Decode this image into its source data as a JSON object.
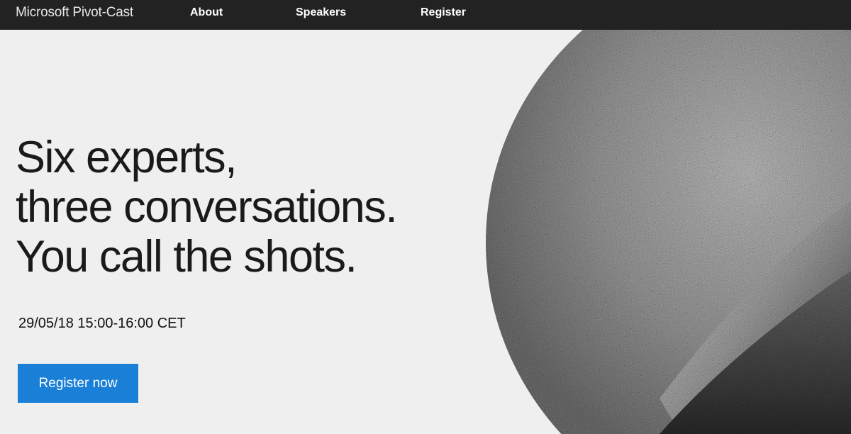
{
  "nav": {
    "brand": "Microsoft Pivot-Cast",
    "links": [
      {
        "label": "About"
      },
      {
        "label": "Speakers"
      },
      {
        "label": "Register"
      }
    ]
  },
  "hero": {
    "headline_lines": [
      "Six experts,",
      "three conversations.",
      "You call the shots."
    ],
    "date": "29/05/18 15:00-16:00 CET",
    "cta_label": "Register now"
  },
  "colors": {
    "navbar_bg": "#222222",
    "page_bg": "#efefef",
    "cta_bg": "#1a7fd6",
    "text": "#1a1a1a"
  }
}
